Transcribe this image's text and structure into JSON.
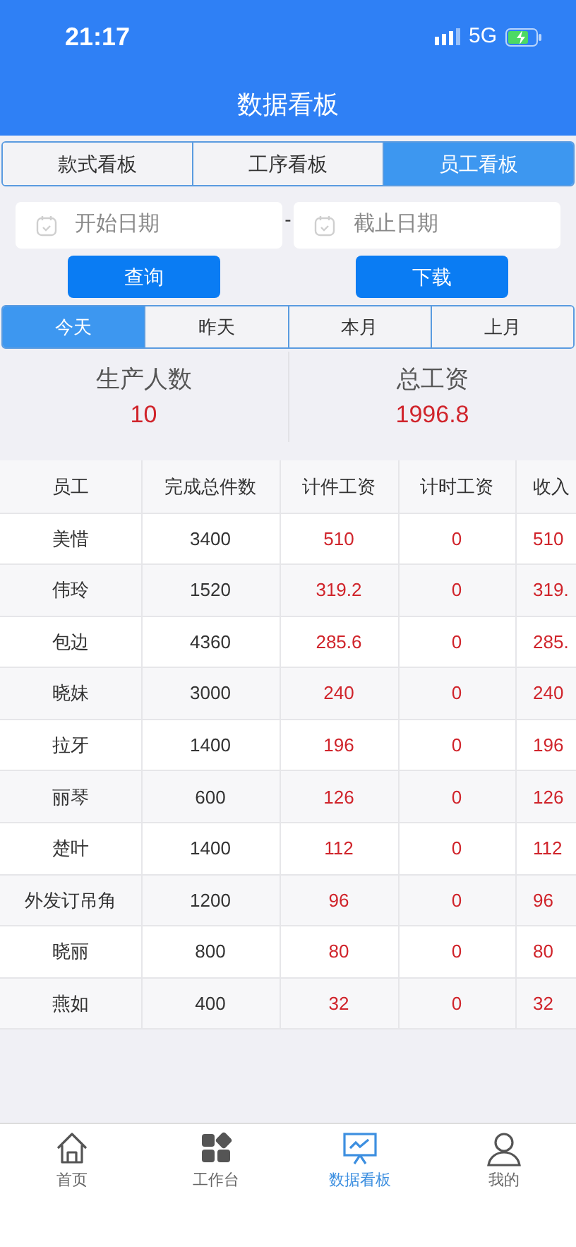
{
  "status_bar": {
    "time": "21:17",
    "network": "5G"
  },
  "header": {
    "title": "数据看板"
  },
  "board_tabs": [
    {
      "label": "款式看板",
      "selected": false
    },
    {
      "label": "工序看板",
      "selected": false
    },
    {
      "label": "员工看板",
      "selected": true
    }
  ],
  "date_range": {
    "start": {
      "placeholder": "开始日期"
    },
    "separator": "-",
    "end": {
      "placeholder": "截止日期"
    }
  },
  "buttons": [
    {
      "label": "查询"
    },
    {
      "label": "下载"
    }
  ],
  "period_tabs": [
    {
      "label": "今天",
      "selected": true
    },
    {
      "label": "昨天",
      "selected": false
    },
    {
      "label": "本月",
      "selected": false
    },
    {
      "label": "上月",
      "selected": false
    }
  ],
  "summary": [
    {
      "label": "生产人数",
      "value": "10"
    },
    {
      "label": "总工资",
      "value": "1996.8"
    }
  ],
  "table": {
    "columns": [
      "员工",
      "完成总件数",
      "计件工资",
      "计时工资",
      "收入"
    ],
    "rows": [
      [
        "美惜",
        "3400",
        "510",
        "0",
        "510"
      ],
      [
        "伟玲",
        "1520",
        "319.2",
        "0",
        "319."
      ],
      [
        "包边",
        "4360",
        "285.6",
        "0",
        "285."
      ],
      [
        "晓妹",
        "3000",
        "240",
        "0",
        "240"
      ],
      [
        "拉牙",
        "1400",
        "196",
        "0",
        "196"
      ],
      [
        "丽琴",
        "600",
        "126",
        "0",
        "126"
      ],
      [
        "楚叶",
        "1400",
        "112",
        "0",
        "112"
      ],
      [
        "外发订吊角",
        "1200",
        "96",
        "0",
        "96"
      ],
      [
        "晓丽",
        "800",
        "80",
        "0",
        "80"
      ],
      [
        "燕如",
        "400",
        "32",
        "0",
        "32"
      ]
    ]
  },
  "bottom_nav": [
    {
      "label": "首页",
      "kind": "home",
      "selected": false
    },
    {
      "label": "工作台",
      "kind": "workbench",
      "selected": false
    },
    {
      "label": "数据看板",
      "kind": "dashboard",
      "selected": true
    },
    {
      "label": "我的",
      "kind": "profile",
      "selected": false
    }
  ]
}
